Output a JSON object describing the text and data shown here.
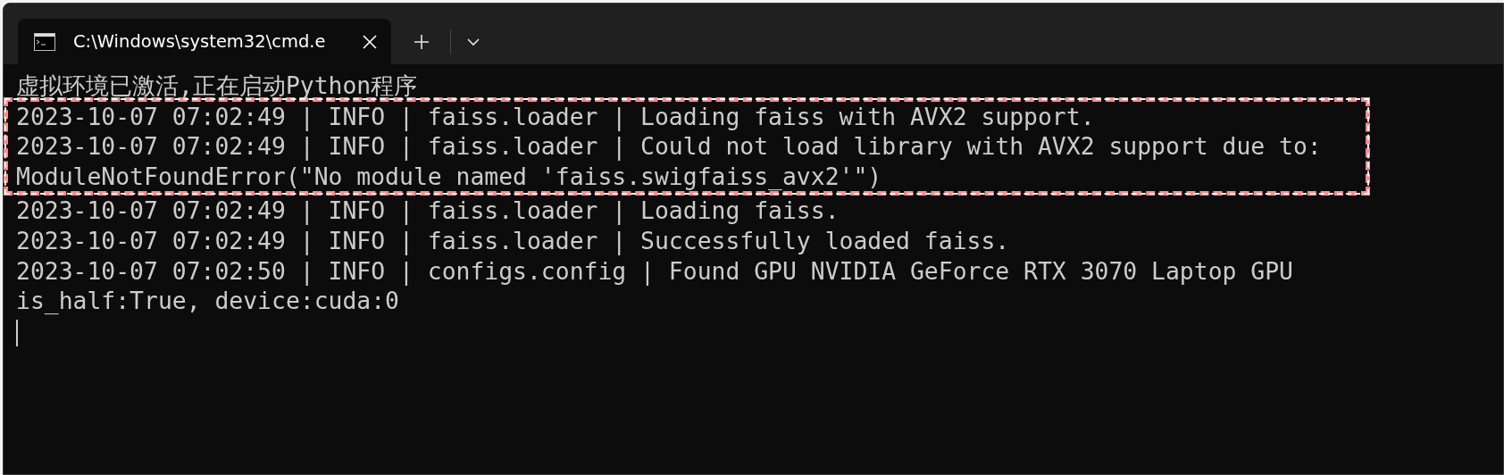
{
  "tab": {
    "title": "C:\\Windows\\system32\\cmd.e",
    "selected": true
  },
  "terminal": {
    "lines": [
      {
        "text": "虚拟环境已激活,正在启动Python程序",
        "highlighted": false
      },
      {
        "text": "2023-10-07 07:02:49 | INFO | faiss.loader | Loading faiss with AVX2 support.",
        "highlighted": true
      },
      {
        "text": "2023-10-07 07:02:49 | INFO | faiss.loader | Could not load library with AVX2 support due to:",
        "highlighted": true
      },
      {
        "text": "ModuleNotFoundError(\"No module named 'faiss.swigfaiss_avx2'\")",
        "highlighted": true
      },
      {
        "text": "2023-10-07 07:02:49 | INFO | faiss.loader | Loading faiss.",
        "highlighted": false
      },
      {
        "text": "2023-10-07 07:02:49 | INFO | faiss.loader | Successfully loaded faiss.",
        "highlighted": false
      },
      {
        "text": "2023-10-07 07:02:50 | INFO | configs.config | Found GPU NVIDIA GeForce RTX 3070 Laptop GPU",
        "highlighted": false
      },
      {
        "text": "is_half:True, device:cuda:0",
        "highlighted": false
      }
    ]
  }
}
